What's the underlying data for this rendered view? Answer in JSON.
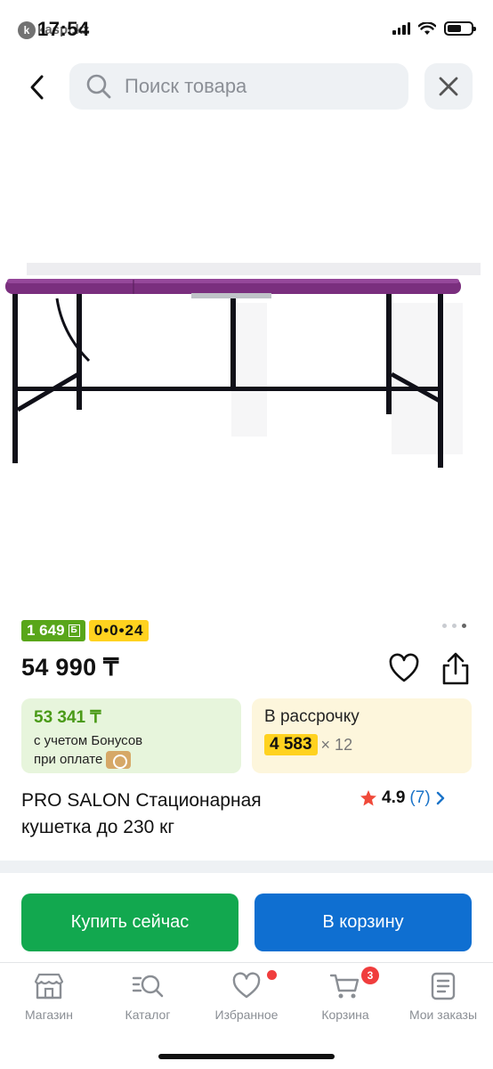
{
  "status": {
    "time": "17:54",
    "watermark": "kaspi.kz"
  },
  "header": {
    "search_placeholder": "Поиск товара"
  },
  "product": {
    "bonus_badge": "1 649",
    "bonus_badge_symbol": "Б",
    "credit_badge": "0•0•24",
    "price": "54 990 ₸",
    "bonus_card": {
      "price": "53 341 ₸",
      "line1": "с учетом Бонусов",
      "line2": "при оплате"
    },
    "installment": {
      "title": "В рассрочку",
      "amount": "4 583",
      "multiplier": "× 12"
    },
    "title": "PRO SALON Стационарная кушетка до 230 кг",
    "rating": {
      "score": "4.9",
      "count": "(7)"
    },
    "carousel": {
      "total": 3,
      "active": 3
    }
  },
  "actions": {
    "buy_now": "Купить сейчас",
    "add_to_cart": "В корзину"
  },
  "tabbar": {
    "items": [
      {
        "label": "Магазин",
        "icon": "shop-icon"
      },
      {
        "label": "Каталог",
        "icon": "catalog-search-icon"
      },
      {
        "label": "Избранное",
        "icon": "heart-icon"
      },
      {
        "label": "Корзина",
        "icon": "cart-icon"
      },
      {
        "label": "Мои заказы",
        "icon": "orders-icon"
      }
    ],
    "cart_count": "3"
  },
  "colors": {
    "green_button": "#12a84f",
    "blue_button": "#0f6fd1",
    "bonus_green": "#59a61a",
    "credit_yellow": "#ffd21f",
    "table_top_purple": "#7a2f7e"
  }
}
